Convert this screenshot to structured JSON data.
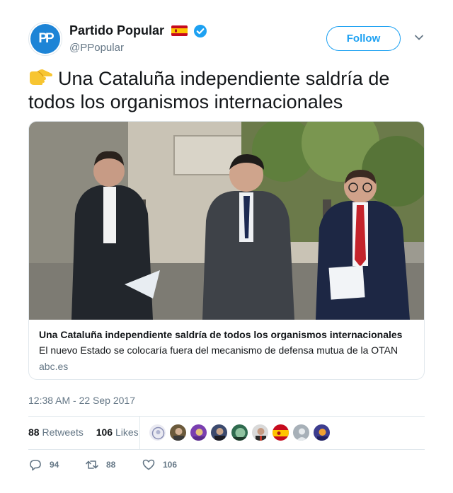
{
  "account": {
    "display_name": "Partido Popular",
    "handle": "@PPopular",
    "avatar_text": "PP",
    "follow_label": "Follow"
  },
  "tweet": {
    "text": "Una Cataluña independiente saldría de todos los organismos internacionales",
    "timestamp": "12:38 AM - 22 Sep 2017"
  },
  "card": {
    "title": "Una Cataluña independiente saldría de todos los organismos internacionales",
    "description": "El nuevo Estado se colocaría fuera del mecanismo de defensa mutua de la OTAN",
    "domain": "abc.es"
  },
  "stats": {
    "retweets_count": "88",
    "retweets_label": "Retweets",
    "likes_count": "106",
    "likes_label": "Likes"
  },
  "actions": {
    "reply_count": "94",
    "retweet_count": "88",
    "like_count": "106"
  },
  "icons": [
    "pointing-right-emoji",
    "spain-flag-icon",
    "verified-badge-icon",
    "chevron-down-icon",
    "reply-icon",
    "retweet-icon",
    "heart-icon"
  ],
  "colors": {
    "accent": "#1da1f2",
    "text": "#14171a",
    "secondary": "#657786",
    "border": "#e1e8ed"
  }
}
